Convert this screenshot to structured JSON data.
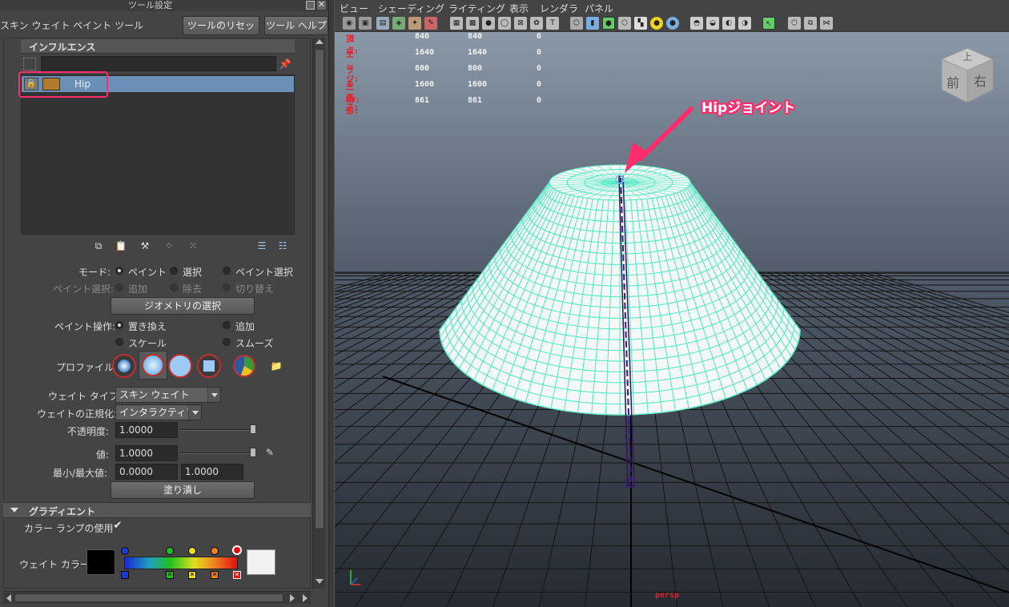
{
  "tool_panel": {
    "header_title": "ツール設定",
    "tool_name": "スキン ウェイト ペイント ツール",
    "reset_button": "ツールのリセット",
    "help_button": "ツール ヘルプ",
    "influence": {
      "section_title": "インフルエンス",
      "search_value": "",
      "items": [
        {
          "name": "Hip"
        }
      ]
    },
    "mode": {
      "label": "モード:",
      "options": [
        "ペイント",
        "選択",
        "ペイント選択"
      ],
      "selected": "ペイント"
    },
    "paint_select": {
      "label": "ペイント選択:",
      "options": [
        "追加",
        "除去",
        "切り替え"
      ]
    },
    "select_geometry_button": "ジオメトリの選択",
    "paint_op": {
      "label": "ペイント操作:",
      "options": [
        "置き換え",
        "追加",
        "スケール",
        "スムーズ"
      ],
      "selected": "置き換え"
    },
    "profile_label": "プロファイル:",
    "weight_type": {
      "label": "ウェイト タイプ:",
      "value": "スキン ウェイト"
    },
    "normalize": {
      "label": "ウェイトの正規化:",
      "value": "インタラクティブ"
    },
    "opacity": {
      "label": "不透明度:",
      "value": "1.0000",
      "fraction": 1.0
    },
    "value": {
      "label": "値:",
      "value": "1.0000",
      "fraction": 1.0
    },
    "minmax": {
      "label": "最小/最大値:",
      "min": "0.0000",
      "max": "1.0000"
    },
    "flood_button": "塗り潰し",
    "gradient": {
      "section_title": "グラディエント",
      "color_ramp_label": "カラー ランプの使用",
      "color_ramp_checked": true,
      "weight_color_label": "ウェイト カラー:"
    }
  },
  "viewport": {
    "menu": [
      "ビュー",
      "シェーディング",
      "ライティング",
      "表示",
      "レンダラ",
      "パネル"
    ],
    "hud": [
      {
        "label": "頂点:",
        "v1": "840",
        "v2": "840",
        "v3": "0"
      },
      {
        "label": "エッジ:",
        "v1": "1640",
        "v2": "1640",
        "v3": "0"
      },
      {
        "label": "フェース:",
        "v1": "800",
        "v2": "800",
        "v3": "0"
      },
      {
        "label": "三角形:",
        "v1": "1600",
        "v2": "1600",
        "v3": "0"
      },
      {
        "label": "UV:",
        "v1": "861",
        "v2": "861",
        "v3": "0"
      }
    ],
    "view_cube": {
      "top": "上",
      "front": "前",
      "right": "右"
    },
    "annotation": "Hipジョイント",
    "camera_label": "persp"
  },
  "colors": {
    "accent_pink": "#ff2d6e",
    "mesh": "#5ef0c8",
    "hud_red": "#e0202a",
    "selection_blue": "#6a90b8"
  }
}
